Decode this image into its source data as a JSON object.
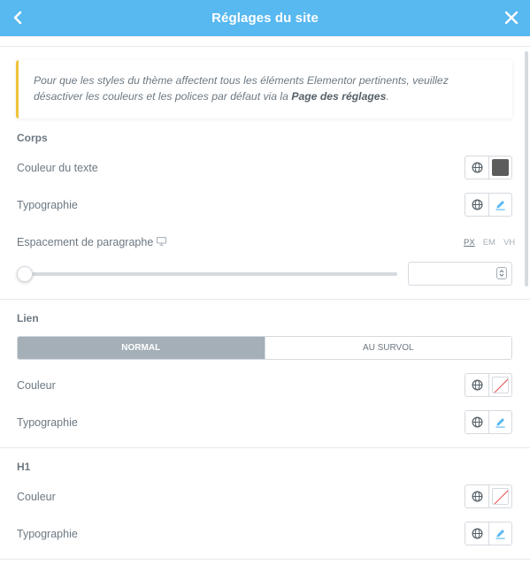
{
  "header": {
    "title": "Réglages du site"
  },
  "notice": {
    "text_before": "Pour que les styles du thème affectent tous les éléments Elementor pertinents, veuillez désactiver les couleurs et les polices par défaut via la ",
    "link_text": "Page des réglages",
    "text_after": "."
  },
  "corps": {
    "title": "Corps",
    "text_color_label": "Couleur du texte",
    "text_color_value": "#5c5c5c",
    "typography_label": "Typographie",
    "spacing_label": "Espacement de paragraphe",
    "units": [
      "PX",
      "EM",
      "VH"
    ],
    "active_unit": "PX",
    "spacing_value": "",
    "slider_fraction": 0
  },
  "lien": {
    "title": "Lien",
    "tabs": [
      {
        "label": "NORMAL",
        "active": true
      },
      {
        "label": "AU SURVOL",
        "active": false
      }
    ],
    "color_label": "Couleur",
    "typography_label": "Typographie"
  },
  "h1": {
    "title": "H1",
    "color_label": "Couleur",
    "typography_label": "Typographie"
  },
  "colors": {
    "header_bg": "#58b8f0",
    "notice_accent": "#f0c33c",
    "edit_icon": "#58b8f0",
    "no_color_slash": "#e2504c"
  },
  "icons": {
    "back": "chevron-left-icon",
    "close": "close-icon",
    "global": "globe-icon",
    "edit": "pencil-icon",
    "responsive": "desktop-icon"
  }
}
